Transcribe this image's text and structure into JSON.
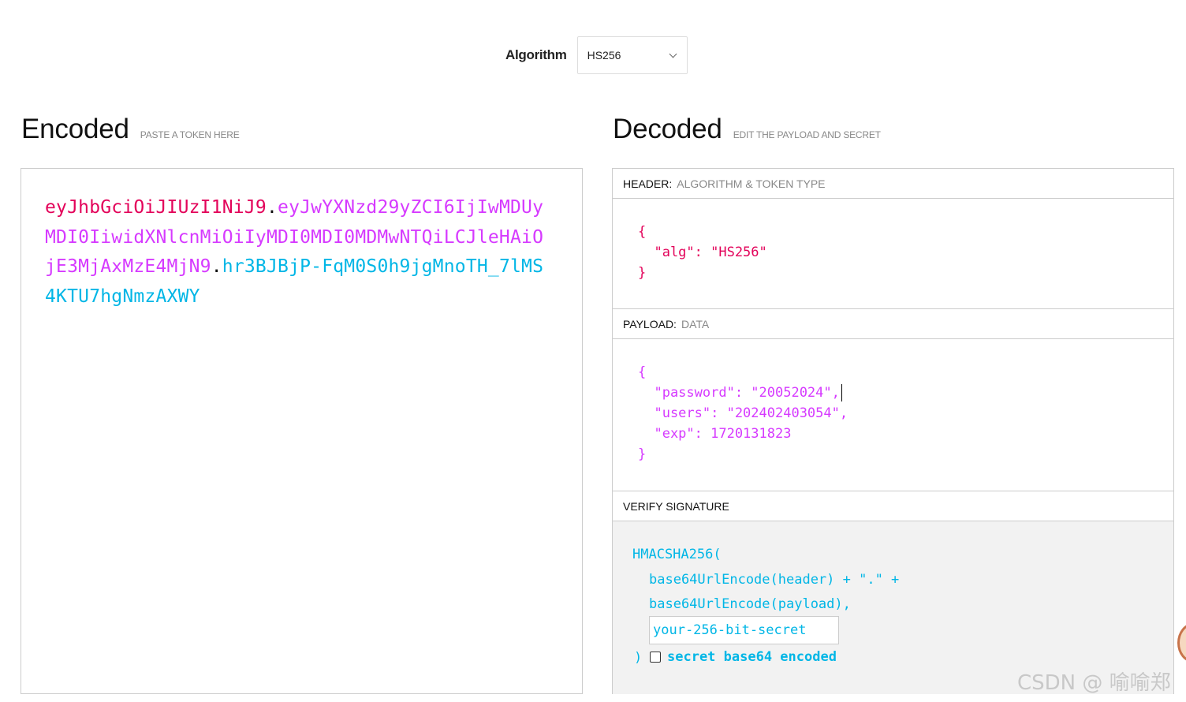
{
  "algorithm": {
    "label": "Algorithm",
    "selected": "HS256"
  },
  "encoded": {
    "title": "Encoded",
    "subtitle": "PASTE A TOKEN HERE",
    "token_header": "eyJhbGciOiJIUzI1NiJ9",
    "token_payload": "eyJwYXNzd29yZCI6IjIwMDUyMDI0IiwidXNlcnMiOiIyMDI0MDI0MDMwNTQiLCJleHAiOjE3MjAxMzE4MjN9",
    "token_signature": "hr3BJBjP-FqM0S0h9jgMnoTH_7lMS4KTU7hgNmzAXWY",
    "dot": "."
  },
  "decoded": {
    "title": "Decoded",
    "subtitle": "EDIT THE PAYLOAD AND SECRET",
    "header_section": {
      "label": "HEADER:",
      "sublabel": "ALGORITHM & TOKEN TYPE",
      "lines": [
        "{",
        "  \"alg\": \"HS256\"",
        "}"
      ]
    },
    "payload_section": {
      "label": "PAYLOAD:",
      "sublabel": "DATA",
      "lines": [
        "{",
        "  \"password\": \"20052024\",",
        "  \"users\": \"202402403054\",",
        "  \"exp\": 1720131823",
        "}"
      ]
    },
    "verify_section": {
      "label": "VERIFY SIGNATURE",
      "fn_open": "HMACSHA256(",
      "line1": "base64UrlEncode(header) + \".\" +",
      "line2": "base64UrlEncode(payload),",
      "secret_placeholder": "your-256-bit-secret",
      "close": ")",
      "checkbox_label": "secret base64 encoded"
    }
  },
  "watermark": "CSDN @ 喻喻郑"
}
